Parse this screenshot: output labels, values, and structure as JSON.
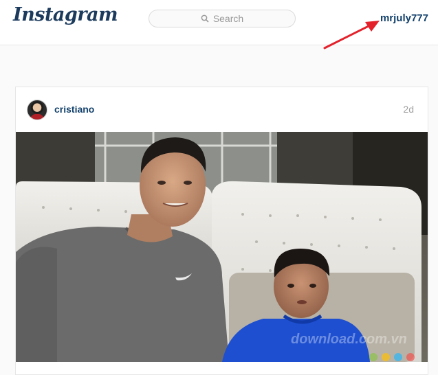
{
  "header": {
    "logo_text": "Instagram",
    "search_placeholder": "Search",
    "username": "mrjuly777"
  },
  "post": {
    "author": "cristiano",
    "age": "2d"
  },
  "watermark": "download.com.vn",
  "colors": {
    "link": "#12406b",
    "arrow": "#e3212b",
    "border": "#e6e6e6"
  }
}
